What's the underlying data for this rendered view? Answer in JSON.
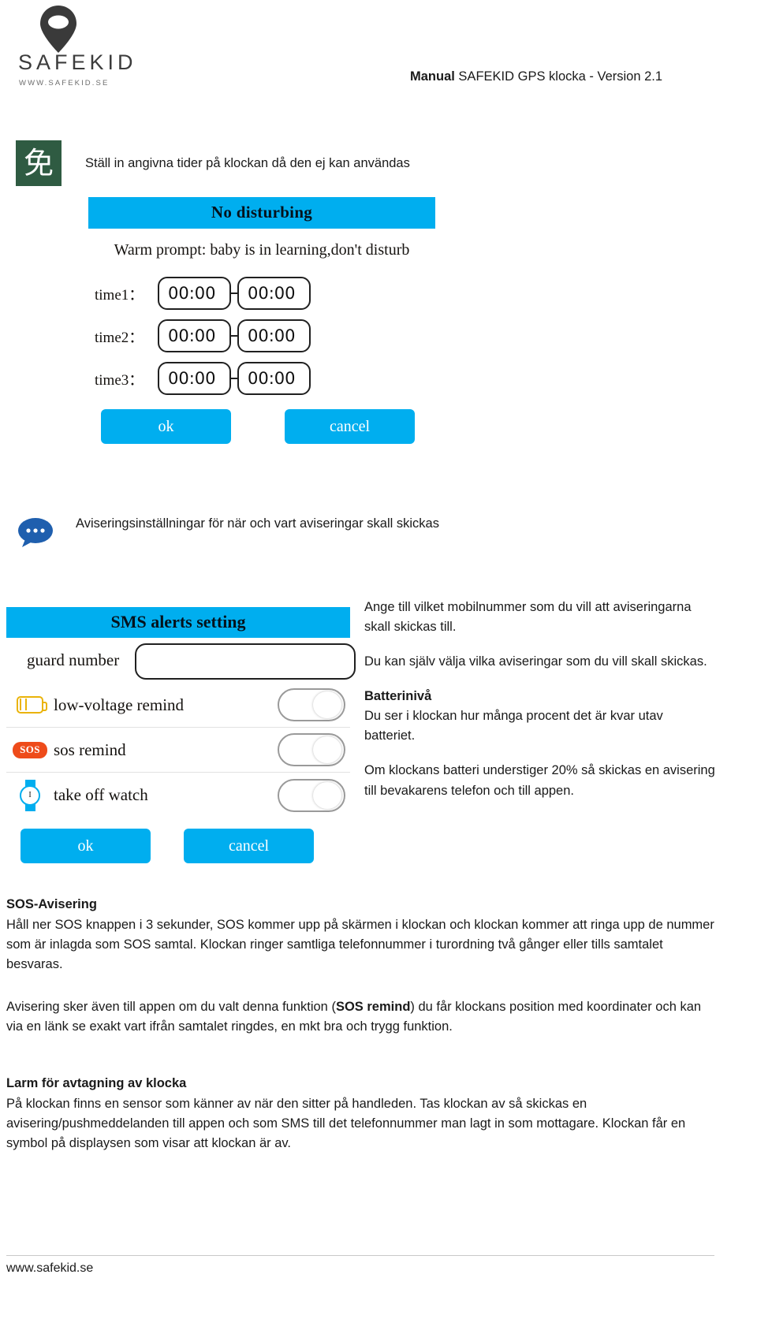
{
  "header": {
    "logo_wordmark": "SAFEKID",
    "logo_url": "WWW.SAFEKID.SE",
    "title_bold": "Manual",
    "title_rest": " SAFEKID GPS klocka - Version 2.1"
  },
  "section_nodisturb": {
    "icon_glyph": "免",
    "caption": "Ställ in angivna tider på klockan då den ej kan användas",
    "dialog": {
      "title": "No disturbing",
      "subtitle": "Warm prompt: baby is in learning,don't disturb",
      "rows": [
        {
          "label": "time1：",
          "from": "00:00",
          "to": "00:00"
        },
        {
          "label": "time2：",
          "from": "00:00",
          "to": "00:00"
        },
        {
          "label": "time3：",
          "from": "00:00",
          "to": "00:00"
        }
      ],
      "ok_label": "ok",
      "cancel_label": "cancel"
    }
  },
  "section_avisering": {
    "caption": "Aviseringsinställningar för när och vart aviseringar skall skickas",
    "dialog": {
      "title": "SMS alerts setting",
      "guard_label": "guard number",
      "guard_value": "",
      "guard_placeholder": "",
      "toggles": [
        {
          "icon": "battery-icon",
          "label": "low-voltage remind",
          "state": "off"
        },
        {
          "icon": "sos-badge-icon",
          "badge_text": "SOS",
          "label": "sos remind",
          "state": "off"
        },
        {
          "icon": "watch-icon",
          "watch_text": "I",
          "label": "take off watch",
          "state": "off"
        }
      ],
      "ok_label": "ok",
      "cancel_label": "cancel"
    }
  },
  "right_column": {
    "p1": "Ange till vilket mobilnummer som du vill att aviseringarna skall skickas till.",
    "p2": "Du kan själv välja vilka aviseringar som du vill skall skickas.",
    "p3_heading": "Batterinivå",
    "p3_body": "Du ser i klockan hur många procent det är kvar utav batteriet.",
    "p4": "Om klockans batteri understiger 20% så skickas en avisering till bevakarens telefon och till appen."
  },
  "bottom": {
    "sos_heading": "SOS-Avisering",
    "sos_body": "Håll ner SOS knappen i 3 sekunder, SOS kommer upp på skärmen i klockan och klockan kommer att ringa upp de nummer som är inlagda som SOS samtal. Klockan ringer samtliga telefonnummer i turordning två gånger eller tills samtalet besvaras.",
    "app_body_1": "Avisering sker även till appen om du valt denna funktion (",
    "app_body_bold": "SOS remind",
    "app_body_2": ") du får klockans position med koordinater och kan via en länk se exakt vart ifrån samtalet ringdes, en mkt bra och trygg funktion.",
    "avtag_heading": "Larm för avtagning av klocka",
    "avtag_body": "På klockan finns en sensor som känner av när den sitter på handleden. Tas klockan av så skickas en avisering/pushmeddelanden till appen och som SMS till det telefonnummer man lagt in som mottagare.  Klockan får en symbol på displaysen som visar att klockan är av."
  },
  "footer": {
    "url": "www.safekid.se"
  },
  "colors": {
    "accent_blue": "#00AEEF",
    "icon_green": "#2f5b42",
    "battery_yellow": "#EAB308",
    "sos_orange": "#EE4B1A"
  }
}
